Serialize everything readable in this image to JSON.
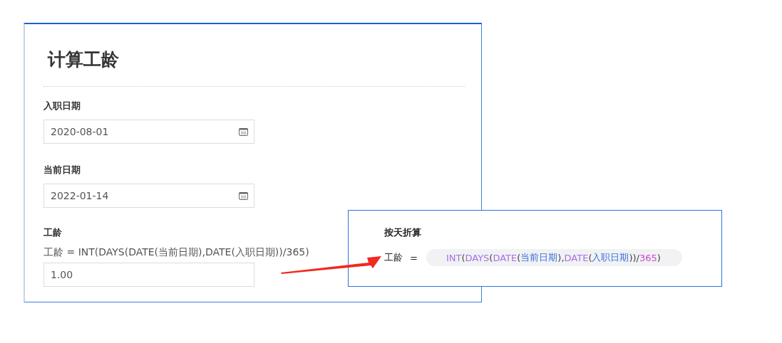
{
  "form": {
    "title": "计算工龄",
    "fields": [
      {
        "label": "入职日期",
        "value": "2020-08-01",
        "kind": "date"
      },
      {
        "label": "当前日期",
        "value": "2022-01-14",
        "kind": "date"
      },
      {
        "label": "工龄",
        "hint": "工龄 = INT(DAYS(DATE(当前日期),DATE(入职日期))/365)",
        "value": "1.00",
        "kind": "number"
      }
    ]
  },
  "callout": {
    "title": "按天折算",
    "name": "工龄",
    "equals": "=",
    "tokens": [
      {
        "text": "INT",
        "kind": "function"
      },
      {
        "text": "(",
        "kind": "paren"
      },
      {
        "text": "DAYS",
        "kind": "function"
      },
      {
        "text": "(",
        "kind": "paren"
      },
      {
        "text": "DATE",
        "kind": "function"
      },
      {
        "text": "(",
        "kind": "paren"
      },
      {
        "text": "当前日期",
        "kind": "field"
      },
      {
        "text": "),",
        "kind": "paren"
      },
      {
        "text": "DATE",
        "kind": "function"
      },
      {
        "text": "(",
        "kind": "paren"
      },
      {
        "text": "入职日期",
        "kind": "field"
      },
      {
        "text": "))",
        "kind": "paren"
      },
      {
        "text": "/",
        "kind": "operator"
      },
      {
        "text": "365",
        "kind": "number"
      },
      {
        "text": ")",
        "kind": "paren"
      }
    ]
  }
}
